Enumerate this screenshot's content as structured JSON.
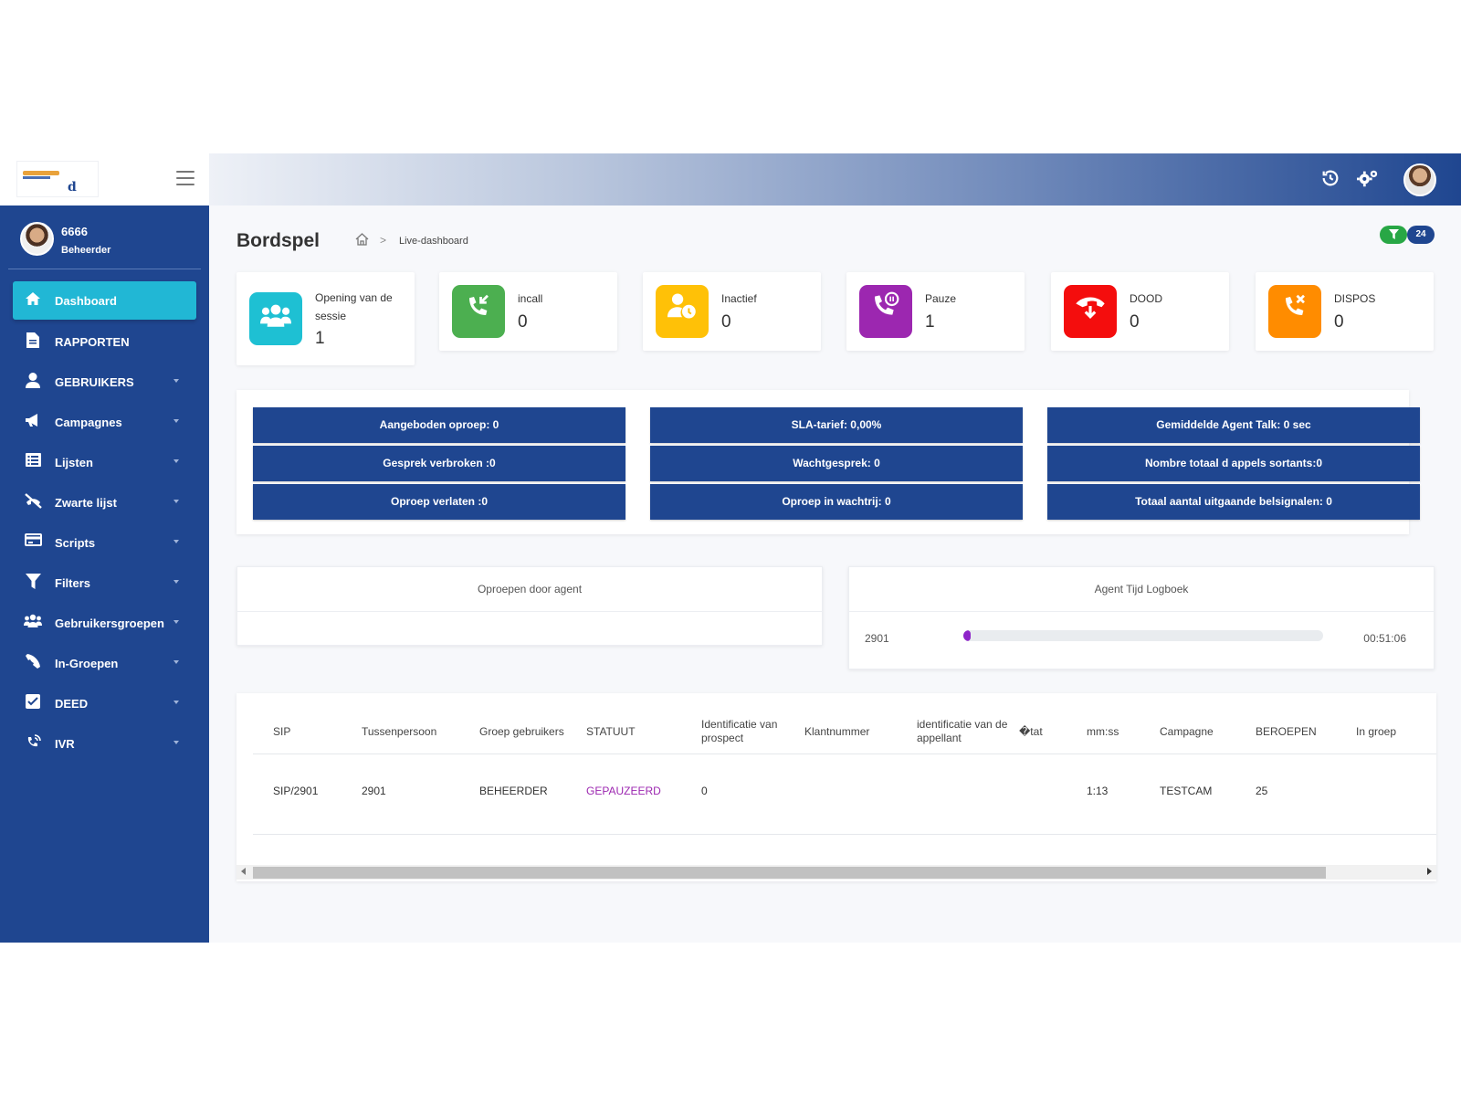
{
  "header": {
    "history_icon": "history-icon",
    "settings_icon": "settings-icon",
    "avatar_icon": "user-avatar-icon"
  },
  "user": {
    "id": "6666",
    "role": "Beheerder"
  },
  "sidebar": {
    "items": [
      {
        "label": "Dashboard",
        "icon": "home-icon"
      },
      {
        "label": "RAPPORTEN",
        "icon": "document-icon"
      },
      {
        "label": "GEBRUIKERS",
        "icon": "user-icon"
      },
      {
        "label": "Campagnes",
        "icon": "megaphone-icon"
      },
      {
        "label": "Lijsten",
        "icon": "list-icon"
      },
      {
        "label": "Zwarte lijst",
        "icon": "blocked-phone-icon"
      },
      {
        "label": "Scripts",
        "icon": "card-icon"
      },
      {
        "label": "Filters",
        "icon": "filter-icon"
      },
      {
        "label": "Gebruikersgroepen",
        "icon": "users-icon"
      },
      {
        "label": "In-Groepen",
        "icon": "phone-icon"
      },
      {
        "label": "DEED",
        "icon": "check-square-icon"
      },
      {
        "label": "IVR",
        "icon": "ivr-phone-icon"
      }
    ]
  },
  "page": {
    "title": "Bordspel",
    "breadcrumb_current": "Live-dashboard",
    "filter_count": "24"
  },
  "stats": [
    {
      "label": "Opening van de sessie",
      "value": "1",
      "color": "#1ec0d3",
      "icon": "users-icon"
    },
    {
      "label": "incall",
      "value": "0",
      "color": "#4caf50",
      "icon": "incoming-call-icon"
    },
    {
      "label": "Inactief",
      "value": "0",
      "color": "#ffc107",
      "icon": "user-clock-icon"
    },
    {
      "label": "Pauze",
      "value": "1",
      "color": "#9c27b0",
      "icon": "phone-pause-icon"
    },
    {
      "label": "DOOD",
      "value": "0",
      "color": "#f40d0d",
      "icon": "hangup-icon"
    },
    {
      "label": "DISPOS",
      "value": "0",
      "color": "#ff8c00",
      "icon": "phone-cancel-icon"
    }
  ],
  "metrics": [
    [
      "Aangeboden oproep: 0",
      "Gesprek verbroken :0",
      "Oproep verlaten :0"
    ],
    [
      "SLA-tarief: 0,00%",
      "Wachtgesprek: 0",
      "Oproep in wachtrij: 0"
    ],
    [
      "Gemiddelde Agent Talk: 0 sec",
      "Nombre totaal d appels sortants:0",
      "Totaal aantal uitgaande belsignalen: 0"
    ]
  ],
  "calls_by_agent": {
    "title": "Oproepen door agent"
  },
  "agent_log": {
    "title": "Agent Tijd Logboek",
    "agent": "2901",
    "time": "00:51:06",
    "progress": 0.02
  },
  "table": {
    "headers": [
      "SIP",
      "Tussenpersoon",
      "Groep gebruikers",
      "STATUUT",
      "Identificatie van prospect",
      "Klantnummer",
      "identificatie van de appellant",
      "�tat",
      "mm:ss",
      "Campagne",
      "BEROEPEN",
      "In groep"
    ],
    "rows": [
      [
        "SIP/2901",
        "2901",
        "BEHEERDER",
        "GEPAUZEERD",
        "0",
        "",
        "",
        "",
        "1:13",
        "TESTCAM",
        "25",
        ""
      ]
    ]
  }
}
